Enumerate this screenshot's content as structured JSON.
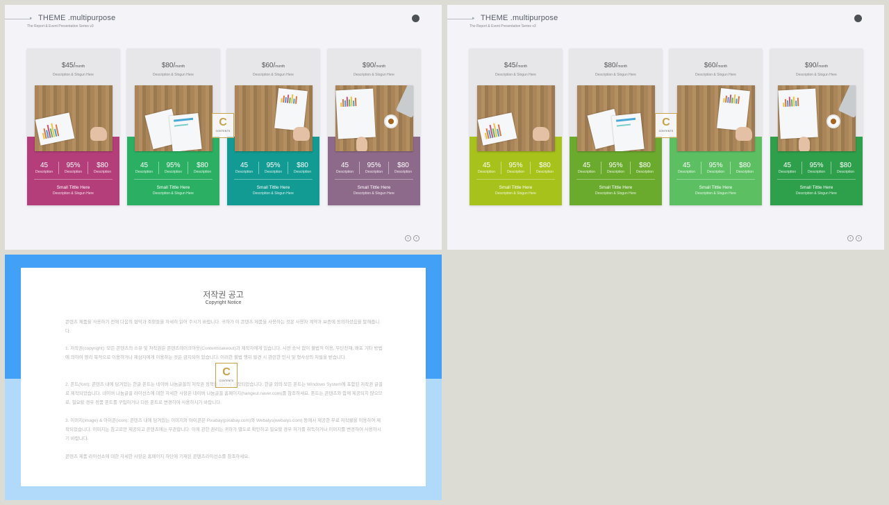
{
  "slides": [
    {
      "title": "THEME .multipurpose",
      "subtitle": "The Report & Event Presentation Series v3",
      "cards": [
        {
          "price": "$45/",
          "per": "month",
          "desc": "Description & Slogun Here",
          "color": "#b43e7a"
        },
        {
          "price": "$80/",
          "per": "month",
          "desc": "Description & Slogun Here",
          "color": "#2bb063"
        },
        {
          "price": "$60/",
          "per": "month",
          "desc": "Description & Slogun Here",
          "color": "#119b92"
        },
        {
          "price": "$90/",
          "per": "month",
          "desc": "Description & Slogun Here",
          "color": "#8e6a8a"
        }
      ]
    },
    {
      "title": "THEME .multipurpose",
      "subtitle": "The Report & Event Presentation Series v3",
      "cards": [
        {
          "price": "$45/",
          "per": "month",
          "desc": "Description & Slogun Here",
          "color": "#a7c21a"
        },
        {
          "price": "$80/",
          "per": "month",
          "desc": "Description & Slogun Here",
          "color": "#6aab2d"
        },
        {
          "price": "$60/",
          "per": "month",
          "desc": "Description & Slogun Here",
          "color": "#5cc062"
        },
        {
          "price": "$90/",
          "per": "month",
          "desc": "Description & Slogun Here",
          "color": "#2e9f4b"
        }
      ]
    }
  ],
  "card_stats": [
    {
      "value": "45",
      "label": "Description"
    },
    {
      "value": "95%",
      "label": "Description"
    },
    {
      "value": "$80",
      "label": "Description"
    }
  ],
  "card_small_title": "Small Tittle Here",
  "card_small_desc": "Description & Slogun Here",
  "nav_icons": [
    "chevron-left-icon",
    "chevron-right-icon"
  ],
  "logo_text": {
    "letter": "C",
    "word": "CONTENTS"
  },
  "notice": {
    "title": "저작권 공고",
    "subtitle": "Copyright Notice",
    "intro": "콘텐츠 제품을 사용하기 전에 다음의 협약과 조항들을 자세히 읽어 주시기 바랍니다. 귀하가 이 콘텐츠 제품을 사용하는 것은 사용자 계약과 보증에 동의하셨음을 말해줍니다.",
    "p1": "1. 저작권(copyright): 모든 콘텐츠의 소유 및 저작권은 콘텐츠테이크아웃(Contentstakeout)과 제작자에게 있습니다. 사전 승낙 없이 불법적 이용, 무단전재, 배포 기타 방법에 의하여 영리 목적으로 이용하거나 제삼자에게 이용하는 것은 금지되어 있습니다. 이러한 불법 행위 발견 시 관련한 민사 및 형사상의 처벌을 받습니다.",
    "p2": "2. 폰트(font): 콘텐츠 내에 담겨있는 한글 폰트는 네이버 나눔글꼴의 저작권 정책을 따라서 제작되었습니다. 한글 외의 모든 폰트는 Windows System에 포함된 저작권 글꼴로 제작되었습니다. 네이버 나눔글꼴 라이선스에 대한 자세한 사항은 네이버 나눔글꼴 홈페이지(hangeul.naver.com)를 참조하세요. 폰트는 콘텐츠와 함께 제공되지 않으므로, 필요할 경우 정품 폰트를 구입하거나 다른 폰트로 변경하여 사용하시기 바랍니다.",
    "p3": "3. 이미지(image) & 아이콘(icon): 콘텐츠 내에 담겨있는 이미지와 아이콘은 Pixabay(pixabay.com)와 Webalys(webalys.com) 등에서 제공한 무료 저작물을 이용하여 제작되었습니다. 이미지는 참고로만 제공되고 콘텐츠에는 무관합니다. 이에 관한 권리는 귀하가 별도로 확인하고 필요할 경우 허가를 취득하거나 이미지를 변경하여 사용하시기 바랍니다.",
    "footer": "콘텐츠 제품 라이선스에 대한 자세한 사항은 홈페이지 하단에 기재된 콘텐츠라이선스를 참조하세요."
  }
}
